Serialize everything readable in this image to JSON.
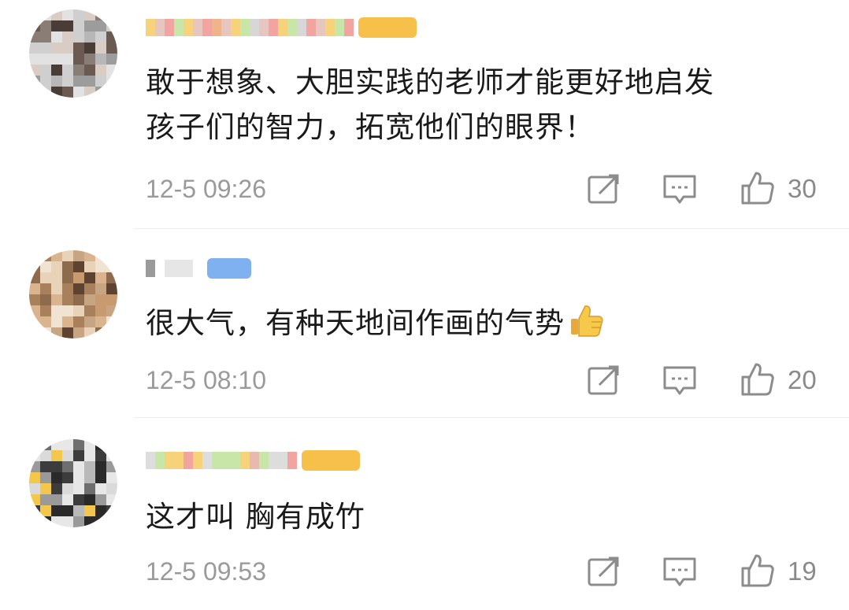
{
  "comments": [
    {
      "text_lines": [
        "敢于想象、大胆实践的老师才能更好地启发",
        "孩子们的智力，拓宽他们的眼界！"
      ],
      "time": "12-5 09:26",
      "likes": "30",
      "badge_color": "#f6c04a"
    },
    {
      "text_lines": [
        "很大气，有种天地间作画的气势"
      ],
      "has_emoji": "thumbs-up-emoji",
      "time": "12-5 08:10",
      "likes": "20",
      "badge_color": "#7fb0f0"
    },
    {
      "text_lines": [
        "这才叫 胸有成竹"
      ],
      "time": "12-5 09:53",
      "likes": "19",
      "badge_color": "#f6c04a"
    }
  ],
  "icons": {
    "share": "share-icon",
    "reply": "reply-icon",
    "like": "like-icon"
  },
  "colors": {
    "text": "#1a1a1a",
    "meta": "#9a9a9a",
    "icon": "#8c8c8c",
    "divider": "#ececec"
  }
}
